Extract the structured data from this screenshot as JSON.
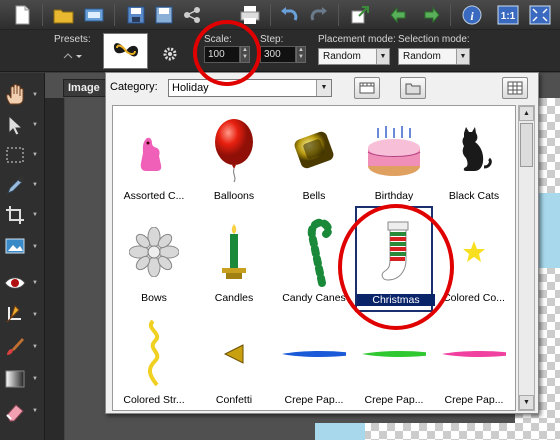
{
  "options": {
    "presets_label": "Presets:",
    "scale_label": "Scale:",
    "scale_value": "100",
    "step_label": "Step:",
    "step_value": "300",
    "placement_label": "Placement mode:",
    "placement_value": "Random",
    "selection_label": "Selection mode:",
    "selection_value": "Random"
  },
  "canvas": {
    "tab_label": "Image"
  },
  "tube_picker": {
    "category_label": "Category:",
    "category_value": "Holiday",
    "tubes": [
      {
        "label": "Assorted C...",
        "icon": "peeps-icon"
      },
      {
        "label": "Balloons",
        "icon": "balloon-icon"
      },
      {
        "label": "Bells",
        "icon": "bells-icon"
      },
      {
        "label": "Birthday",
        "icon": "cake-icon"
      },
      {
        "label": "Black Cats",
        "icon": "cat-icon"
      },
      {
        "label": "Bows",
        "icon": "bow-icon"
      },
      {
        "label": "Candles",
        "icon": "candle-icon"
      },
      {
        "label": "Candy Canes",
        "icon": "candy-cane-icon"
      },
      {
        "label": "Christmas",
        "icon": "stocking-icon",
        "selected": true
      },
      {
        "label": "Colored Co...",
        "icon": "star-icon"
      },
      {
        "label": "Colored Str...",
        "icon": "streamer-icon"
      },
      {
        "label": "Confetti",
        "icon": "confetti-icon"
      },
      {
        "label": "Crepe Pap...",
        "icon": "crepe-blue-icon"
      },
      {
        "label": "Crepe Pap...",
        "icon": "crepe-green-icon"
      },
      {
        "label": "Crepe Pap...",
        "icon": "crepe-pink-icon"
      }
    ]
  },
  "colors": {
    "annotation": "#e00000",
    "selection": "#0a246a"
  }
}
